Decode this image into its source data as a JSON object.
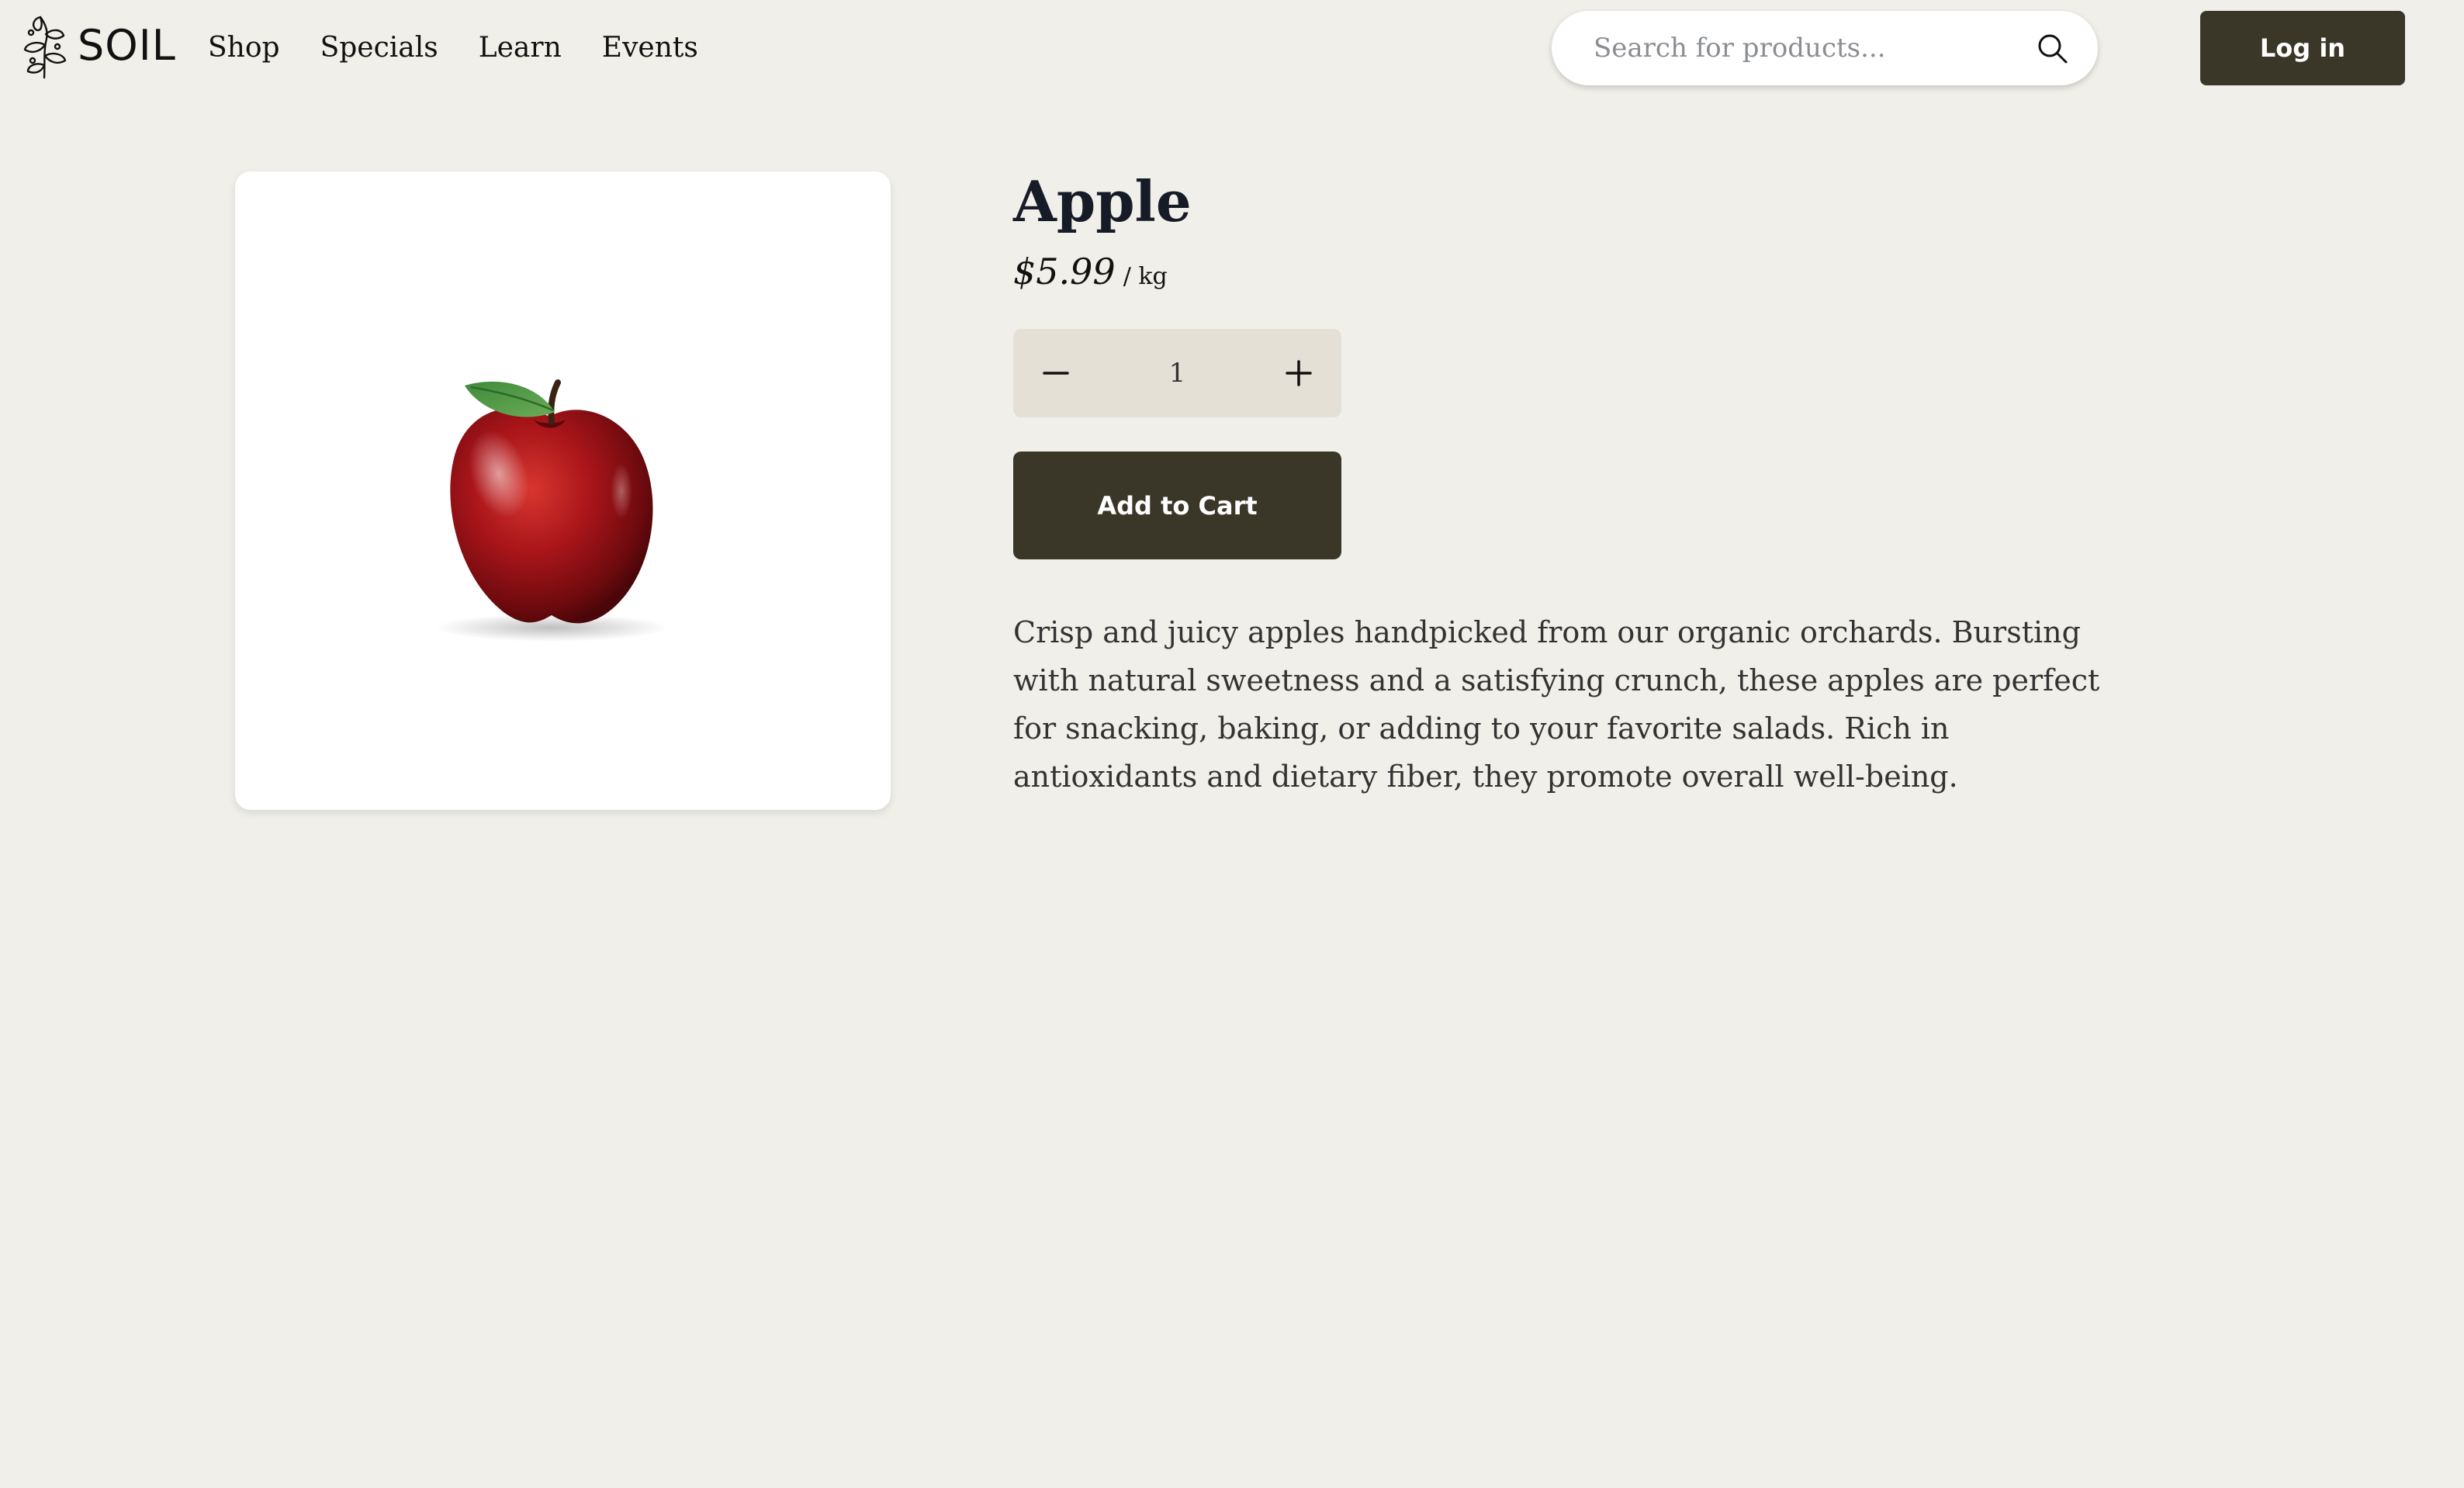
{
  "header": {
    "logo_text": "SOIL",
    "nav": [
      "Shop",
      "Specials",
      "Learn",
      "Events"
    ],
    "search": {
      "placeholder": "Search for products...",
      "value": ""
    },
    "login_label": "Log in"
  },
  "product": {
    "title": "Apple",
    "price": "$5.99",
    "unit": "/ kg",
    "quantity": "1",
    "add_to_cart_label": "Add to Cart",
    "description": "Crisp and juicy apples handpicked from our organic orchards. Bursting with natural sweetness and a satisfying crunch, these apples are perfect for snacking, baking, or adding to your favorite salads. Rich in antioxidants and dietary fiber, they promote overall well-being.",
    "image_icon": "apple-image"
  },
  "colors": {
    "background": "#f0efea",
    "primary_button": "#3a3628",
    "stepper_bg": "#e4e0d5",
    "card_bg": "#ffffff",
    "title": "#171b27"
  },
  "icons": {
    "logo": "soil-leaf-logo-icon",
    "search": "search-icon",
    "minus": "minus-icon",
    "plus": "plus-icon"
  }
}
